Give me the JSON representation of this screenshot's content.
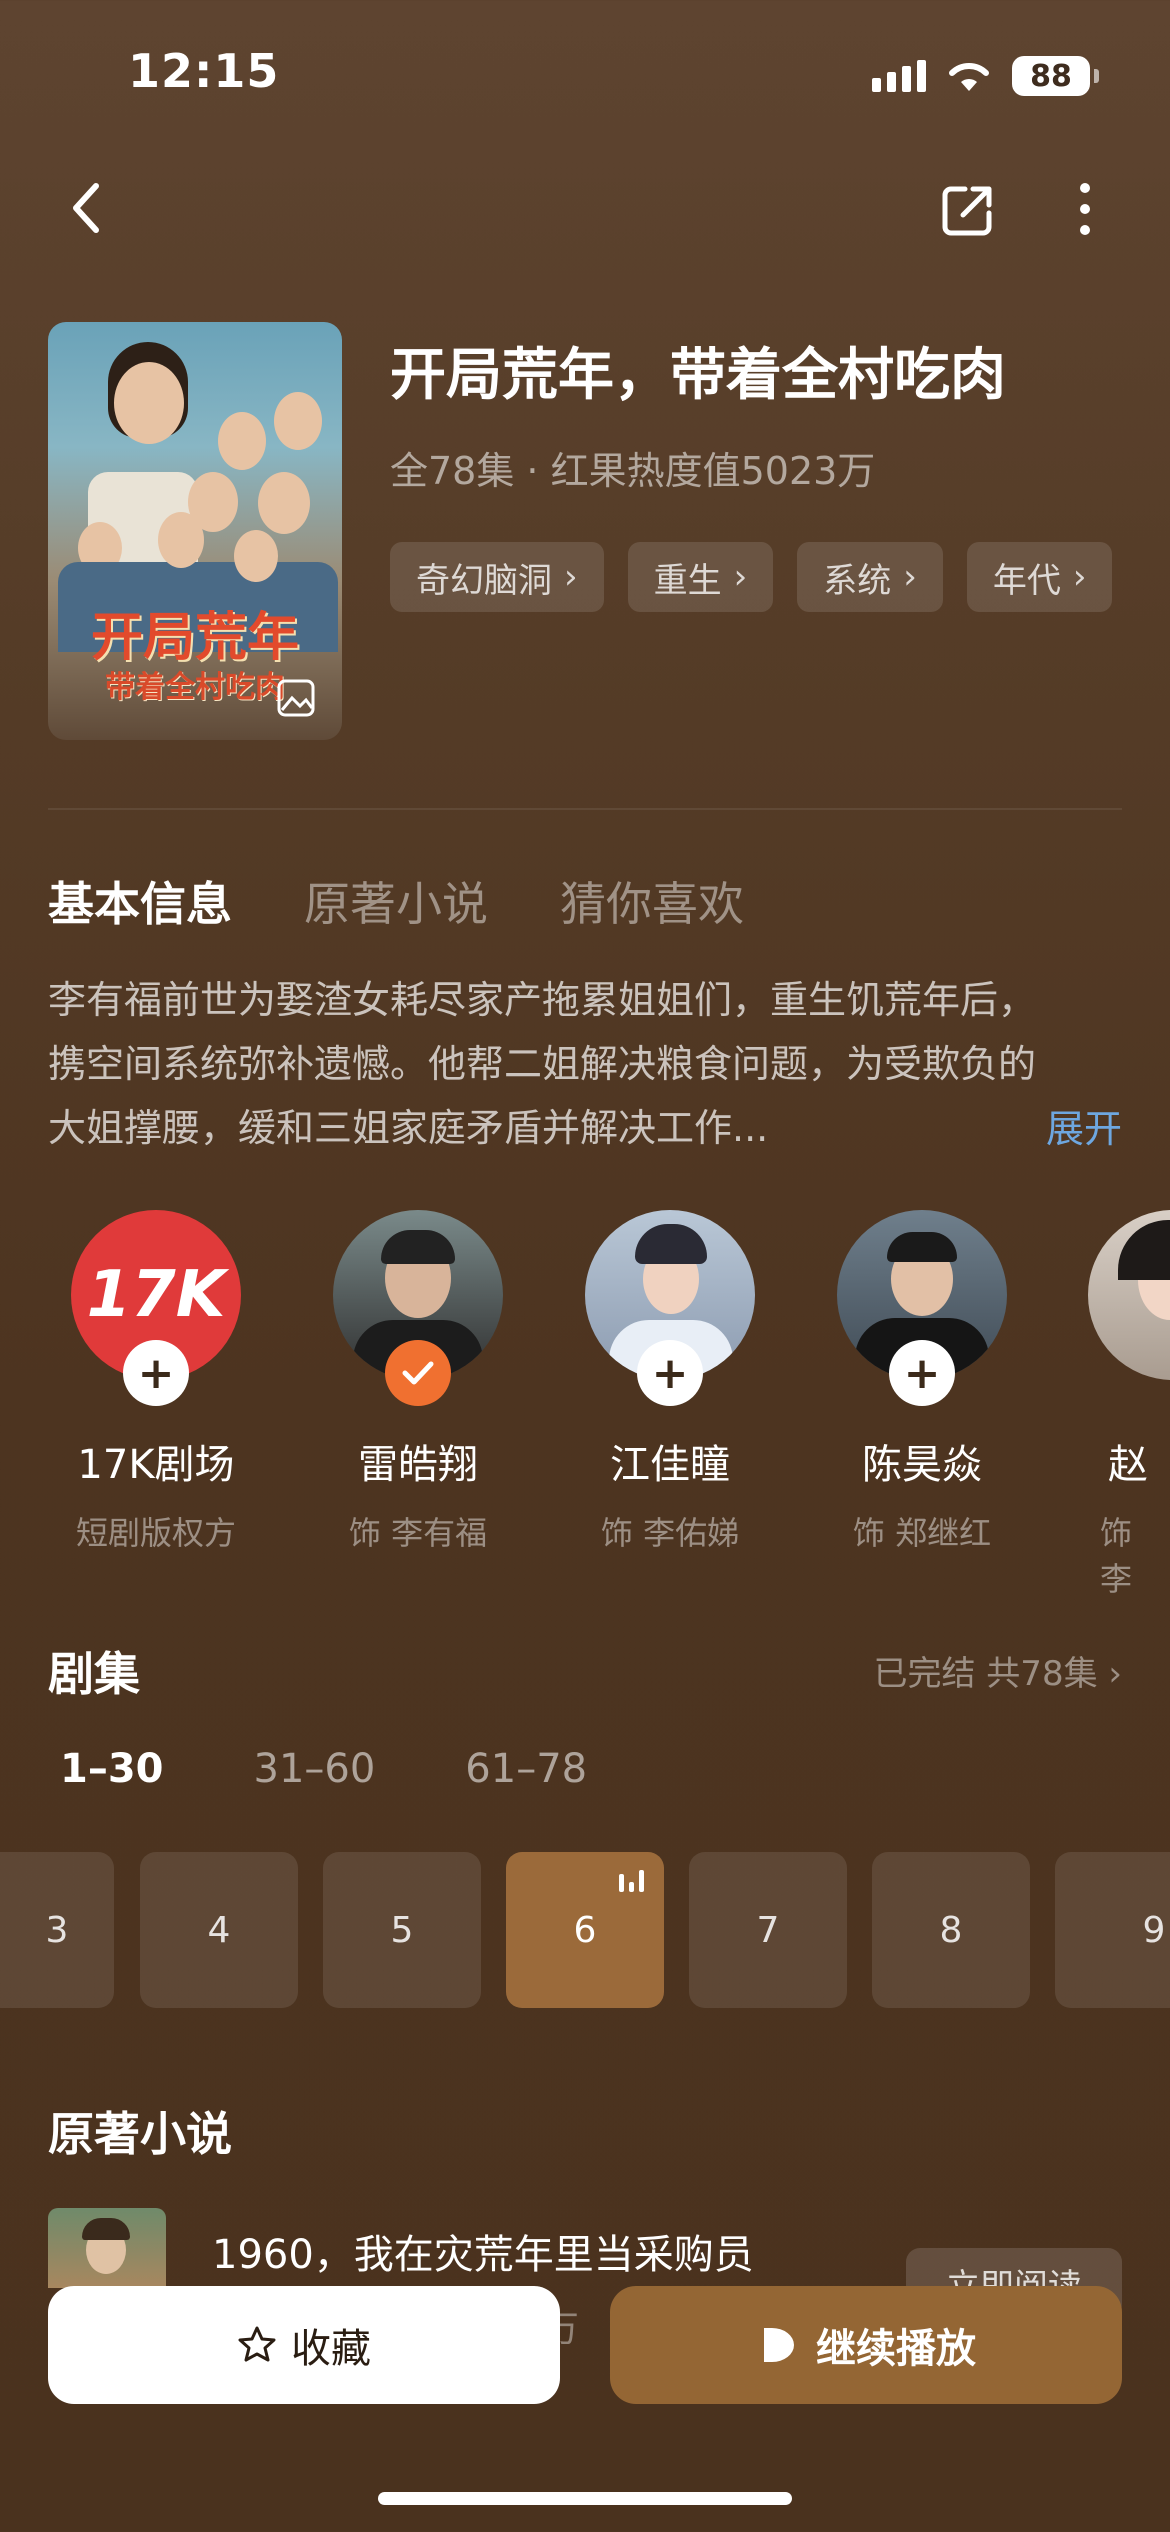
{
  "status": {
    "time": "12:15",
    "battery": "88"
  },
  "show": {
    "title": "开局荒年，带着全村吃肉",
    "meta": "全78集 · 红果热度值5023万",
    "tags": [
      "奇幻脑洞",
      "重生",
      "系统",
      "年代"
    ]
  },
  "poster": {
    "title": "开局荒年",
    "subtitle": "带着全村吃肉"
  },
  "sections": {
    "tabs": [
      "基本信息",
      "原著小说",
      "猜你喜欢"
    ]
  },
  "synopsis": {
    "text": "李有福前世为娶渣女耗尽家产拖累姐姐们，重生饥荒年后，携空间系统弥补遗憾。他帮二姐解决粮食问题，为受欺负的大姐撑腰，缓和三姐家庭矛盾并解决工作...",
    "expand": "展开"
  },
  "cast": [
    {
      "name": "17K剧场",
      "role": "短剧版权方",
      "avatar_text": "17K",
      "followed": false
    },
    {
      "name": "雷皓翔",
      "role": "饰 李有福",
      "followed": true
    },
    {
      "name": "江佳瞳",
      "role": "饰 李佑娣",
      "followed": false
    },
    {
      "name": "陈昊焱",
      "role": "饰 郑继红",
      "followed": false
    },
    {
      "name": "赵",
      "role": "饰 李",
      "followed": false
    }
  ],
  "episodes": {
    "title": "剧集",
    "status": "已完结 共78集",
    "ranges": [
      "1–30",
      "31–60",
      "61–78"
    ],
    "items": [
      "3",
      "4",
      "5",
      "6",
      "7",
      "8",
      "9"
    ],
    "current": "6"
  },
  "novel": {
    "section_title": "原著小说",
    "name": "1960，我在灾荒年里当采购员",
    "read_label": "立即阅读",
    "sub": "5万"
  },
  "bottom": {
    "favorite_label": "收藏",
    "play_label": "继续播放"
  },
  "colors": {
    "accent": "#946634",
    "follow_badge": "#f07030",
    "link": "#6ea7e0"
  }
}
